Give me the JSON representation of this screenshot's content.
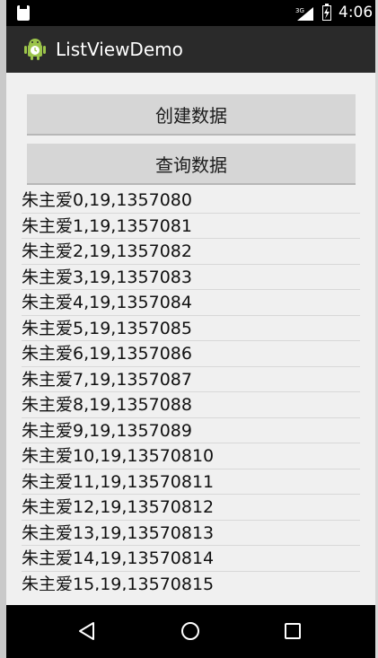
{
  "status_bar": {
    "network": "3G",
    "time": "4:06"
  },
  "action_bar": {
    "title": "ListViewDemo",
    "icon": "android-icon"
  },
  "buttons": {
    "create_label": "创建数据",
    "query_label": "查询数据"
  },
  "list": {
    "items": [
      "朱主爱0,19,1357080",
      "朱主爱1,19,1357081",
      "朱主爱2,19,1357082",
      "朱主爱3,19,1357083",
      "朱主爱4,19,1357084",
      "朱主爱5,19,1357085",
      "朱主爱6,19,1357086",
      "朱主爱7,19,1357087",
      "朱主爱8,19,1357088",
      "朱主爱9,19,1357089",
      "朱主爱10,19,13570810",
      "朱主爱11,19,13570811",
      "朱主爱12,19,13570812",
      "朱主爱13,19,13570813",
      "朱主爱14,19,13570814",
      "朱主爱15,19,13570815"
    ]
  },
  "nav_bar": {
    "back_icon": "triangle-back-icon",
    "home_icon": "circle-home-icon",
    "recent_icon": "square-recent-icon"
  }
}
